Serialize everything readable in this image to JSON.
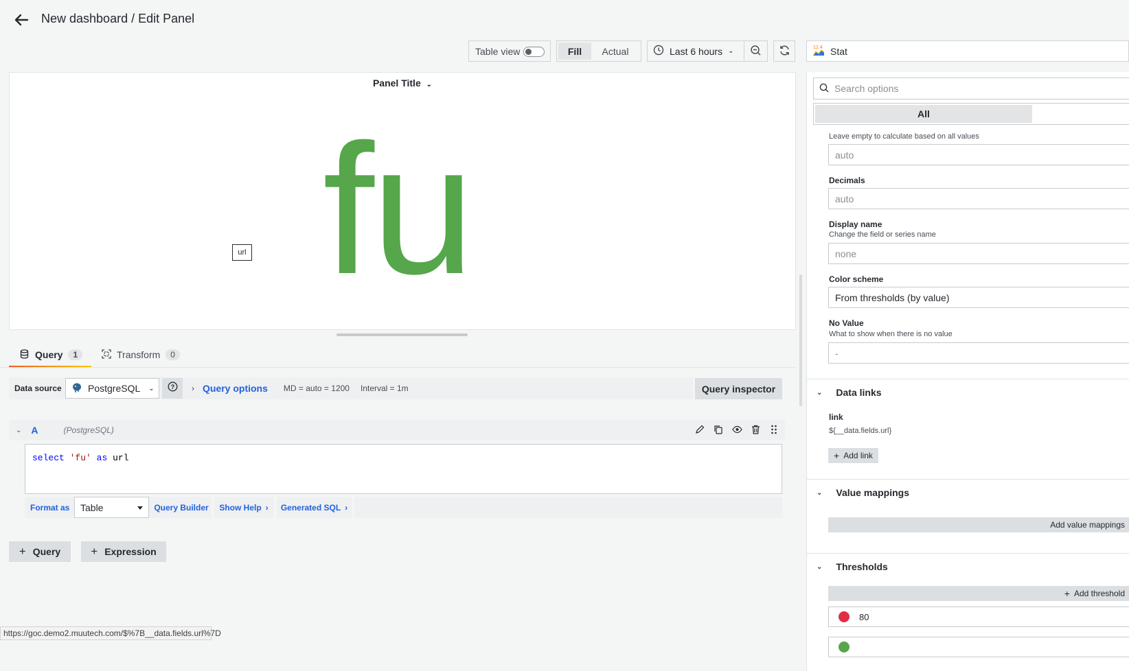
{
  "header": {
    "title": "New dashboard / Edit Panel"
  },
  "toolbar": {
    "table_view_label": "Table view",
    "table_view_on": false,
    "fill_label": "Fill",
    "actual_label": "Actual",
    "time_range": "Last 6 hours"
  },
  "viz_picker": {
    "name": "Stat",
    "icon_text": "12.4"
  },
  "panel": {
    "title": "Panel Title",
    "value": "fu",
    "value_color": "#56a64b",
    "tooltip": "url"
  },
  "tabs": [
    {
      "label": "Query",
      "count": "1"
    },
    {
      "label": "Transform",
      "count": "0"
    }
  ],
  "datasource": {
    "label": "Data source",
    "name": "PostgreSQL",
    "query_options_label": "Query options",
    "md": "MD = auto = 1200",
    "interval": "Interval = 1m",
    "inspector_label": "Query inspector"
  },
  "query": {
    "ref_id": "A",
    "ds_name": "(PostgreSQL)",
    "sql_kw1": "select",
    "sql_str": "'fu'",
    "sql_kw2": "as",
    "sql_ident": "url",
    "format_as_label": "Format as",
    "format_value": "Table",
    "query_builder_label": "Query Builder",
    "show_help_label": "Show Help",
    "generated_sql_label": "Generated SQL"
  },
  "actions": {
    "add_query": "Query",
    "add_expression": "Expression"
  },
  "status_bar": {
    "url": "https://goc.demo2.muutech.com/$%7B__data.fields.url%7D"
  },
  "options": {
    "search_placeholder": "Search options",
    "filter_all": "All",
    "calc_hint": "Leave empty to calculate based on all values",
    "calc_value": "auto",
    "decimals_label": "Decimals",
    "decimals_value": "auto",
    "display_name_label": "Display name",
    "display_name_hint": "Change the field or series name",
    "display_name_value": "none",
    "color_scheme_label": "Color scheme",
    "color_scheme_value": "From thresholds (by value)",
    "no_value_label": "No Value",
    "no_value_hint": "What to show when there is no value",
    "no_value_value": "-",
    "data_links": {
      "title": "Data links",
      "link_title": "link",
      "link_url": "${__data.fields.url}",
      "add_label": "Add link"
    },
    "value_mappings": {
      "title": "Value mappings",
      "add_label": "Add value mappings"
    },
    "thresholds": {
      "title": "Thresholds",
      "add_label": "Add threshold",
      "steps": [
        {
          "value": "80",
          "color": "#e02f44"
        }
      ],
      "base_color": "#56a64b"
    }
  }
}
